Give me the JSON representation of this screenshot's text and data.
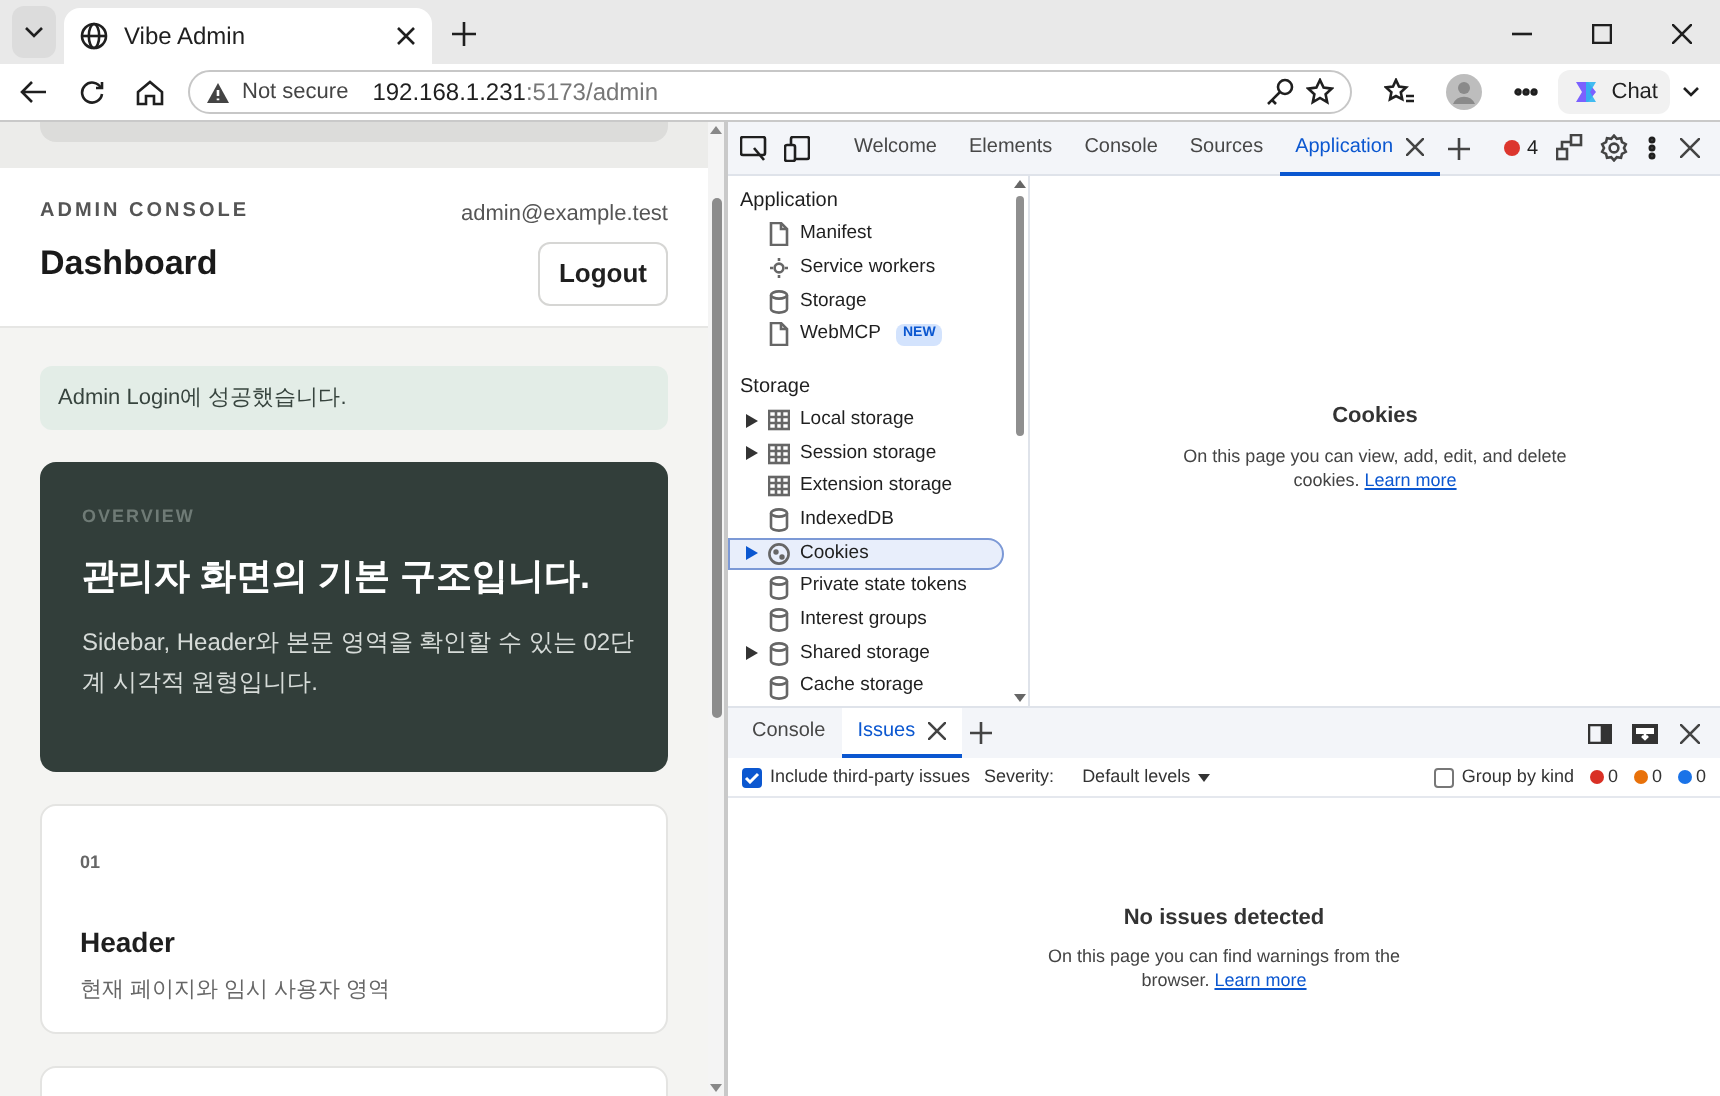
{
  "browser": {
    "tabs": [
      {
        "title": "Vibe Admin",
        "selected": true
      }
    ],
    "address": {
      "security": "Not secure",
      "host": "192.168.1.231",
      "path": ":5173/admin"
    },
    "chat_label": "Chat"
  },
  "page": {
    "header": {
      "eyebrow": "ADMIN CONSOLE",
      "title": "Dashboard",
      "user_email": "admin@example.test",
      "logout_label": "Logout"
    },
    "alert": "Admin Login에 성공했습니다.",
    "overview": {
      "eyebrow": "OVERVIEW",
      "title": "관리자 화면의 기본 구조입니다.",
      "description": "Sidebar, Header와 본문 영역을 확인할 수 있는 02단계 시각적 원형입니다."
    },
    "cards": [
      {
        "number": "01",
        "title": "Header",
        "description": "현재 페이지와 임시 사용자 영역"
      }
    ]
  },
  "devtools": {
    "tabs": [
      {
        "label": "Welcome",
        "selected": false,
        "closable": false
      },
      {
        "label": "Elements",
        "selected": false,
        "closable": false
      },
      {
        "label": "Console",
        "selected": false,
        "closable": false
      },
      {
        "label": "Sources",
        "selected": false,
        "closable": false
      },
      {
        "label": "Application",
        "selected": true,
        "closable": true
      }
    ],
    "error_count": "4",
    "sidebar": [
      {
        "heading": "Application",
        "items": [
          {
            "label": "Manifest",
            "kind": "file",
            "expandable": false,
            "selected": false
          },
          {
            "label": "Service workers",
            "kind": "worker",
            "expandable": false,
            "selected": false
          },
          {
            "label": "Storage",
            "kind": "database",
            "expandable": false,
            "selected": false
          },
          {
            "label": "WebMCP",
            "kind": "file",
            "expandable": false,
            "selected": false,
            "badge": "NEW"
          }
        ]
      },
      {
        "heading": "Storage",
        "items": [
          {
            "label": "Local storage",
            "kind": "table",
            "expandable": true,
            "selected": false
          },
          {
            "label": "Session storage",
            "kind": "table",
            "expandable": true,
            "selected": false
          },
          {
            "label": "Extension storage",
            "kind": "table",
            "expandable": false,
            "selected": false
          },
          {
            "label": "IndexedDB",
            "kind": "database",
            "expandable": false,
            "selected": false
          },
          {
            "label": "Cookies",
            "kind": "cookie",
            "expandable": true,
            "selected": true
          },
          {
            "label": "Private state tokens",
            "kind": "database",
            "expandable": false,
            "selected": false
          },
          {
            "label": "Interest groups",
            "kind": "database",
            "expandable": false,
            "selected": false
          },
          {
            "label": "Shared storage",
            "kind": "database",
            "expandable": true,
            "selected": false
          },
          {
            "label": "Cache storage",
            "kind": "database",
            "expandable": false,
            "selected": false
          }
        ]
      }
    ],
    "main": {
      "title": "Cookies",
      "text": "On this page you can view, add, edit, and delete cookies.",
      "link": "Learn more"
    },
    "drawer": {
      "tabs": [
        {
          "label": "Console",
          "selected": false,
          "closable": false
        },
        {
          "label": "Issues",
          "selected": true,
          "closable": true
        }
      ],
      "include_third_party": {
        "label": "Include third-party issues",
        "checked": true
      },
      "severity_label": "Severity:",
      "severity_value": "Default levels",
      "group_by_kind": {
        "label": "Group by kind",
        "checked": false
      },
      "counts": [
        {
          "value": "0",
          "color": "#d93025"
        },
        {
          "value": "0",
          "color": "#e8710a"
        },
        {
          "value": "0",
          "color": "#1a73e8"
        }
      ],
      "empty": {
        "title": "No issues detected",
        "text": "On this page you can find warnings from the browser.",
        "link": "Learn more"
      }
    }
  }
}
